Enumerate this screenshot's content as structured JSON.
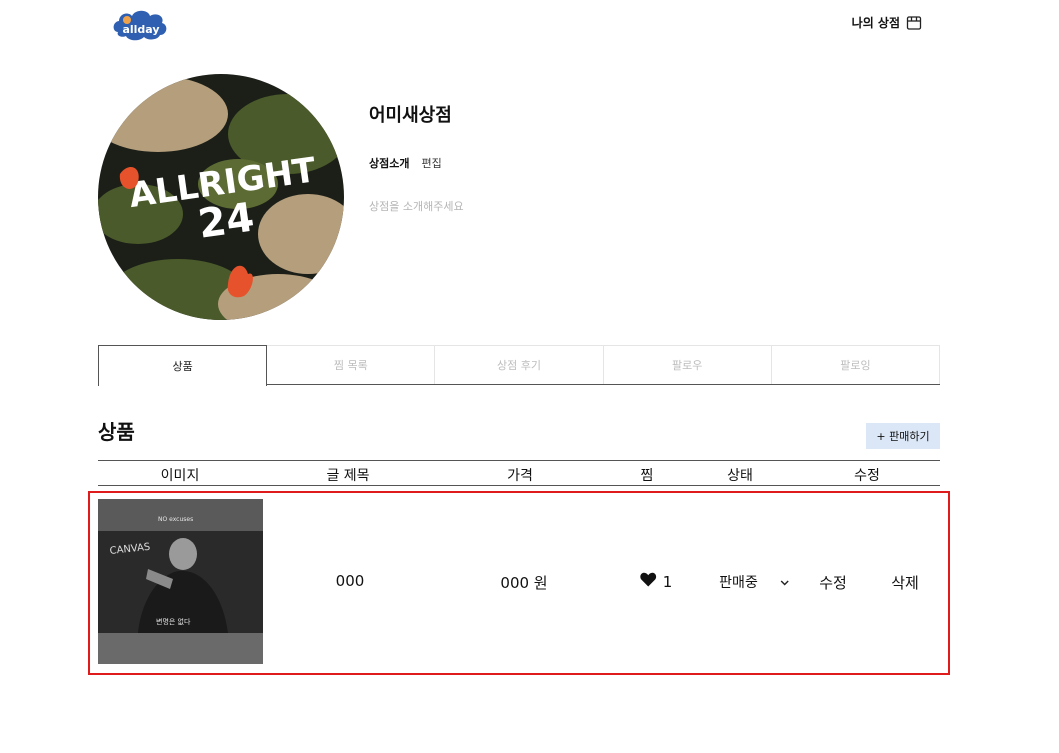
{
  "header": {
    "logo_text": "allday",
    "my_store_label": "나의 상점",
    "my_store_icon": "store-icon"
  },
  "profile": {
    "store_name": "어미새상점",
    "intro_label": "상점소개",
    "edit_label": "편집",
    "intro_placeholder": "상점을 소개해주세요",
    "avatar_text_top": "ALLRIGHT",
    "avatar_text_bottom": "24"
  },
  "tabs": [
    {
      "label": "상품",
      "active": true
    },
    {
      "label": "찜 목록",
      "active": false
    },
    {
      "label": "상점 후기",
      "active": false
    },
    {
      "label": "팔로우",
      "active": false
    },
    {
      "label": "팔로잉",
      "active": false
    }
  ],
  "section": {
    "title": "상품",
    "sell_button": "+ 판매하기"
  },
  "table": {
    "headers": [
      "이미지",
      "글 제목",
      "가격",
      "찜",
      "상태",
      "수정"
    ],
    "rows": [
      {
        "title": "000",
        "price": "000 원",
        "likes": "1",
        "status": "판매중",
        "edit": "수정",
        "delete": "삭제",
        "thumb_texts": [
          "CANVAS",
          "변명은 없다",
          "NO excuses"
        ]
      }
    ]
  },
  "colors": {
    "highlight_outline": "#e01b1b",
    "sell_button_bg": "#dbe7f6",
    "placeholder_text": "#b5b5b5"
  }
}
